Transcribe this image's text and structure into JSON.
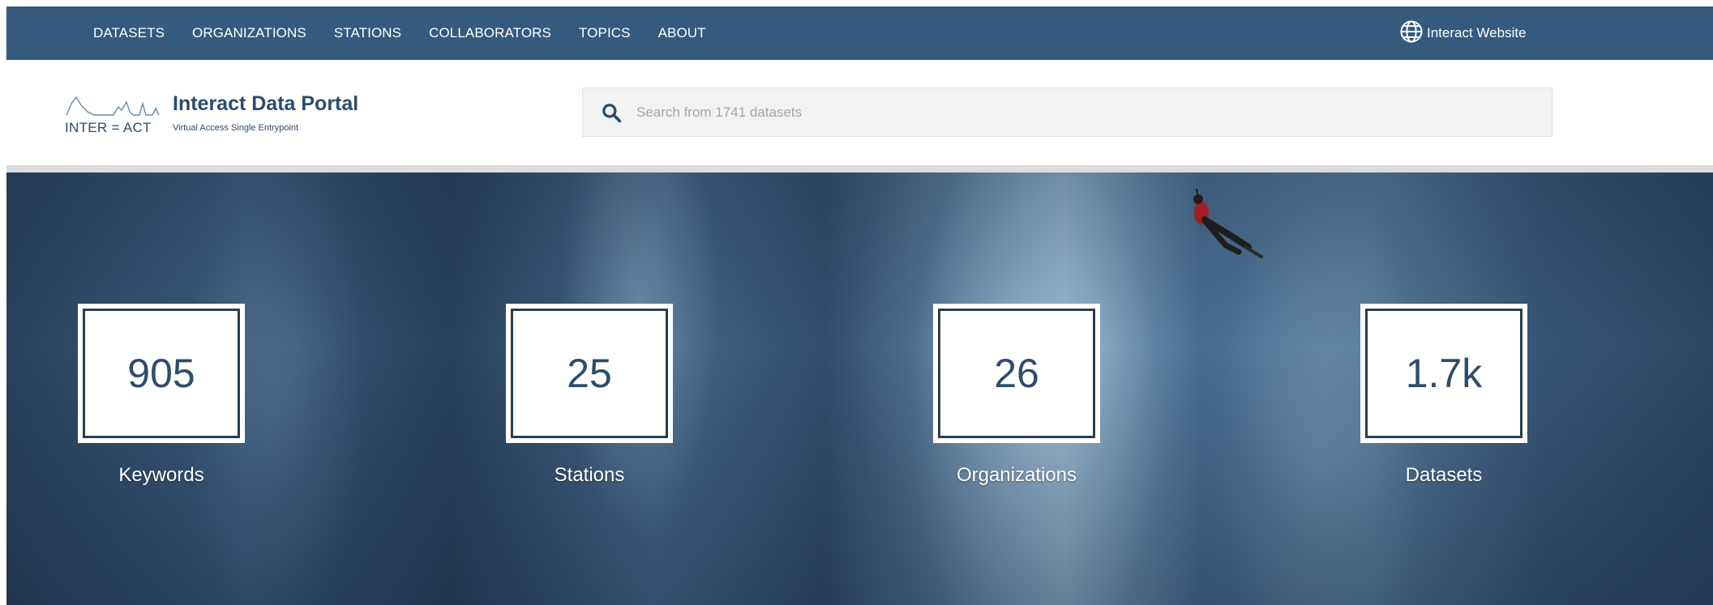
{
  "nav": {
    "links": [
      "DATASETS",
      "ORGANIZATIONS",
      "STATIONS",
      "COLLABORATORS",
      "TOPICS",
      "ABOUT"
    ],
    "external_link": {
      "label": "Interact Website",
      "icon": "globe-icon"
    }
  },
  "header": {
    "title": "Interact Data Portal",
    "wordmark": "INTER = ACT",
    "subtitle": "Virtual Access Single Entrypoint",
    "search": {
      "placeholder": "Search from 1741 datasets",
      "value": "",
      "icon": "search-icon"
    }
  },
  "colors": {
    "nav_bg": "#355a7d",
    "brand_text": "#2c4b6b",
    "stat_number": "#2f4c6c"
  },
  "stats": [
    {
      "value": "905",
      "label": "Keywords"
    },
    {
      "value": "25",
      "label": "Stations"
    },
    {
      "value": "26",
      "label": "Organizations"
    },
    {
      "value": "1.7k",
      "label": "Datasets"
    }
  ]
}
